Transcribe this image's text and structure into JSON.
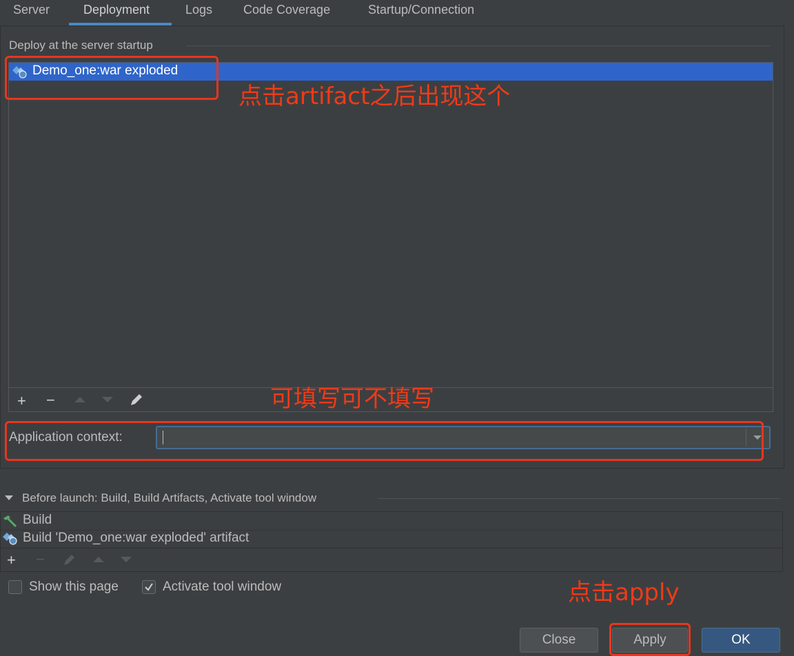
{
  "tabs": [
    {
      "label": "Server"
    },
    {
      "label": "Deployment"
    },
    {
      "label": "Logs"
    },
    {
      "label": "Code Coverage"
    },
    {
      "label": "Startup/Connection"
    }
  ],
  "deploy": {
    "group_title": "Deploy at the server startup",
    "items": [
      "Demo_one:war exploded"
    ]
  },
  "context": {
    "label": "Application context:",
    "value": ""
  },
  "before_launch": {
    "title": "Before launch: Build, Build Artifacts, Activate tool window",
    "tasks": [
      "Build",
      "Build 'Demo_one:war exploded' artifact"
    ]
  },
  "options": {
    "show_page": {
      "label": "Show this page",
      "checked": false
    },
    "activate_tool": {
      "label": "Activate tool window",
      "checked": true
    }
  },
  "buttons": {
    "close": "Close",
    "apply": "Apply",
    "ok": "OK"
  },
  "annotations": {
    "artifact_note": "点击artifact之后出现这个",
    "optional_note": "可填写可不填写",
    "apply_note": "点击apply"
  },
  "colors": {
    "selection": "#2f65ca",
    "annotation": "#f03a18",
    "primary_button": "#365880"
  }
}
